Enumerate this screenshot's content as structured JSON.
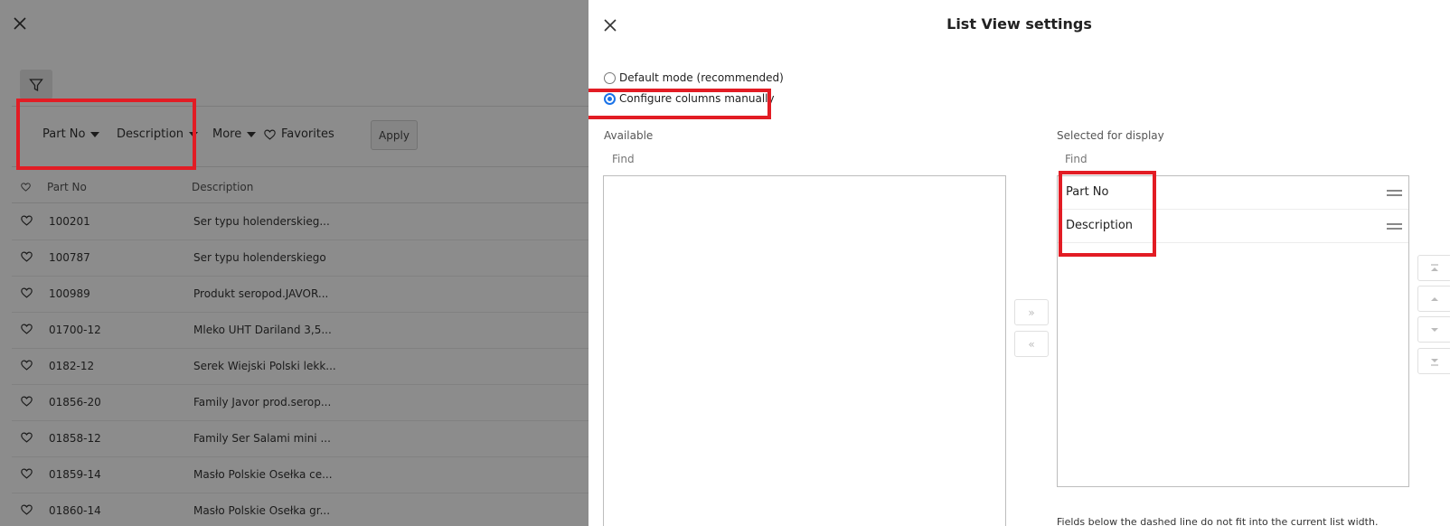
{
  "background": {
    "toolbar": {
      "part_no_label": "Part No",
      "description_label": "Description",
      "more_label": "More",
      "favorites_label": "Favorites",
      "apply_label": "Apply"
    },
    "grid": {
      "headers": [
        "Part No",
        "Description"
      ],
      "rows": [
        {
          "part_no": "100201",
          "description": "Ser typu holenderskieg..."
        },
        {
          "part_no": "100787",
          "description": "Ser typu holenderskiego"
        },
        {
          "part_no": "100989",
          "description": "Produkt seropod.JAVOR..."
        },
        {
          "part_no": "01700-12",
          "description": "Mleko UHT Dariland 3,5..."
        },
        {
          "part_no": "0182-12",
          "description": "Serek Wiejski Polski lekk..."
        },
        {
          "part_no": "01856-20",
          "description": "Family Javor prod.serop..."
        },
        {
          "part_no": "01858-12",
          "description": "Family Ser Salami mini ..."
        },
        {
          "part_no": "01859-14",
          "description": "Masło Polskie Osełka ce..."
        },
        {
          "part_no": "01860-14",
          "description": "Masło Polskie Osełka gr..."
        }
      ]
    }
  },
  "panel": {
    "title": "List View settings",
    "mode_options": [
      {
        "label": "Default mode (recommended)",
        "selected": false
      },
      {
        "label": "Configure columns manually",
        "selected": true
      }
    ],
    "available": {
      "label": "Available",
      "find_placeholder": "Find",
      "items": []
    },
    "selected": {
      "label": "Selected for display",
      "find_placeholder": "Find",
      "items": [
        "Part No",
        "Description"
      ]
    },
    "move_right_glyph": "»",
    "move_left_glyph": "«",
    "note": "Fields below the dashed line do not fit into the current list width."
  },
  "colors": {
    "highlight": "#e21c24",
    "accent": "#1a73e8",
    "overlay": "rgba(0,0,0,0.45)"
  }
}
